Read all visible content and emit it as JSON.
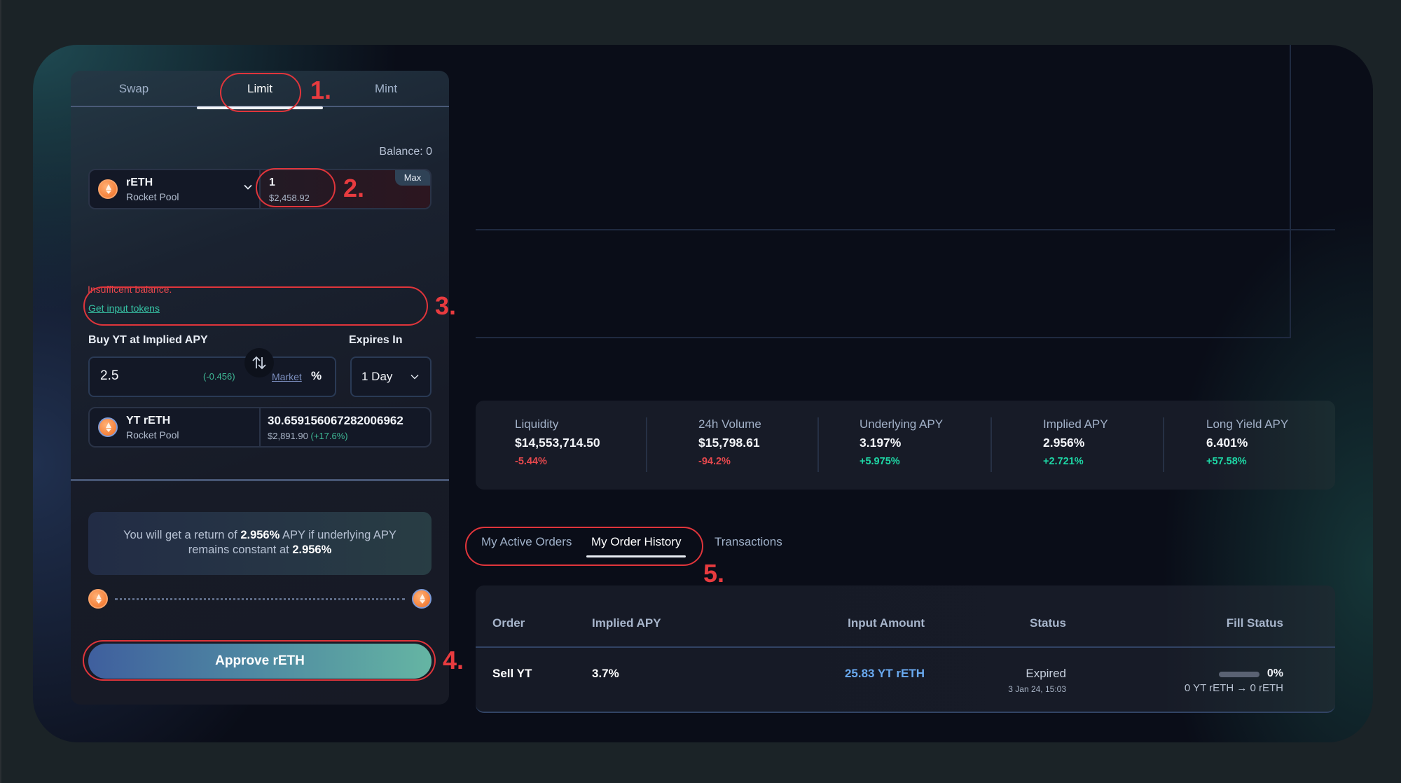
{
  "trade_panel": {
    "tabs": [
      {
        "label": "Swap",
        "active": false
      },
      {
        "label": "Limit",
        "active": true
      },
      {
        "label": "Mint",
        "active": false
      }
    ],
    "balance_label": "Balance: 0",
    "input_token": {
      "symbol": "rETH",
      "protocol": "Rocket Pool",
      "icon": "reth-coin-icon",
      "amount": "1",
      "amount_usd": "$2,458.92",
      "max_label": "Max"
    },
    "error_message": "Insufficent balance.",
    "get_tokens_link": "Get input tokens",
    "apy_label": "Buy YT at Implied APY",
    "expires_label": "Expires In",
    "apy_input": {
      "value": "2.5",
      "delta": "(-0.456)",
      "market_label": "Market",
      "unit": "%"
    },
    "expiry_select": {
      "value": "1 Day"
    },
    "swap_icon": "swap-arrows-icon",
    "output_token": {
      "symbol": "YT rETH",
      "protocol": "Rocket Pool",
      "amount": "30.659156067282006962",
      "amount_usd": "$2,891.90",
      "change": "(+17.6%)"
    },
    "return_info": {
      "prefix": "You will get a return of",
      "apy": "2.956%",
      "middle": "APY if underlying APY",
      "line2": "remains constant at",
      "constant": "2.956%"
    },
    "approve_button": "Approve rETH"
  },
  "annotations": [
    "1.",
    "2.",
    "3.",
    "4.",
    "5."
  ],
  "stats": [
    {
      "label": "Liquidity",
      "value": "$14,553,714.50",
      "change": "-5.44%",
      "trend": "neg"
    },
    {
      "label": "24h Volume",
      "value": "$15,798.61",
      "change": "-94.2%",
      "trend": "neg"
    },
    {
      "label": "Underlying APY",
      "value": "3.197%",
      "change": "+5.975%",
      "trend": "pos"
    },
    {
      "label": "Implied APY",
      "value": "2.956%",
      "change": "+2.721%",
      "trend": "pos"
    },
    {
      "label": "Long Yield APY",
      "value": "6.401%",
      "change": "+57.58%",
      "trend": "pos"
    }
  ],
  "orders": {
    "tabs": [
      {
        "label": "My Active Orders",
        "active": false
      },
      {
        "label": "My Order History",
        "active": true
      },
      {
        "label": "Transactions",
        "active": false
      }
    ],
    "columns": [
      "Order",
      "Implied APY",
      "Input Amount",
      "Status",
      "Fill Status"
    ],
    "rows": [
      {
        "order": "Sell YT",
        "implied_apy": "3.7%",
        "input_amount": "25.83 YT rETH",
        "status": "Expired",
        "status_time": "3 Jan 24, 15:03",
        "fill_percent": 0,
        "fill_label": "0%",
        "fill_detail": "0 YT rETH → 0 rETH"
      }
    ]
  },
  "colors": {
    "accent_teal": "#36c1a3",
    "negative": "#e5484d",
    "positive": "#1ed8a6",
    "link_blue": "#6aaaf0",
    "annotation_red": "#e0353b"
  }
}
